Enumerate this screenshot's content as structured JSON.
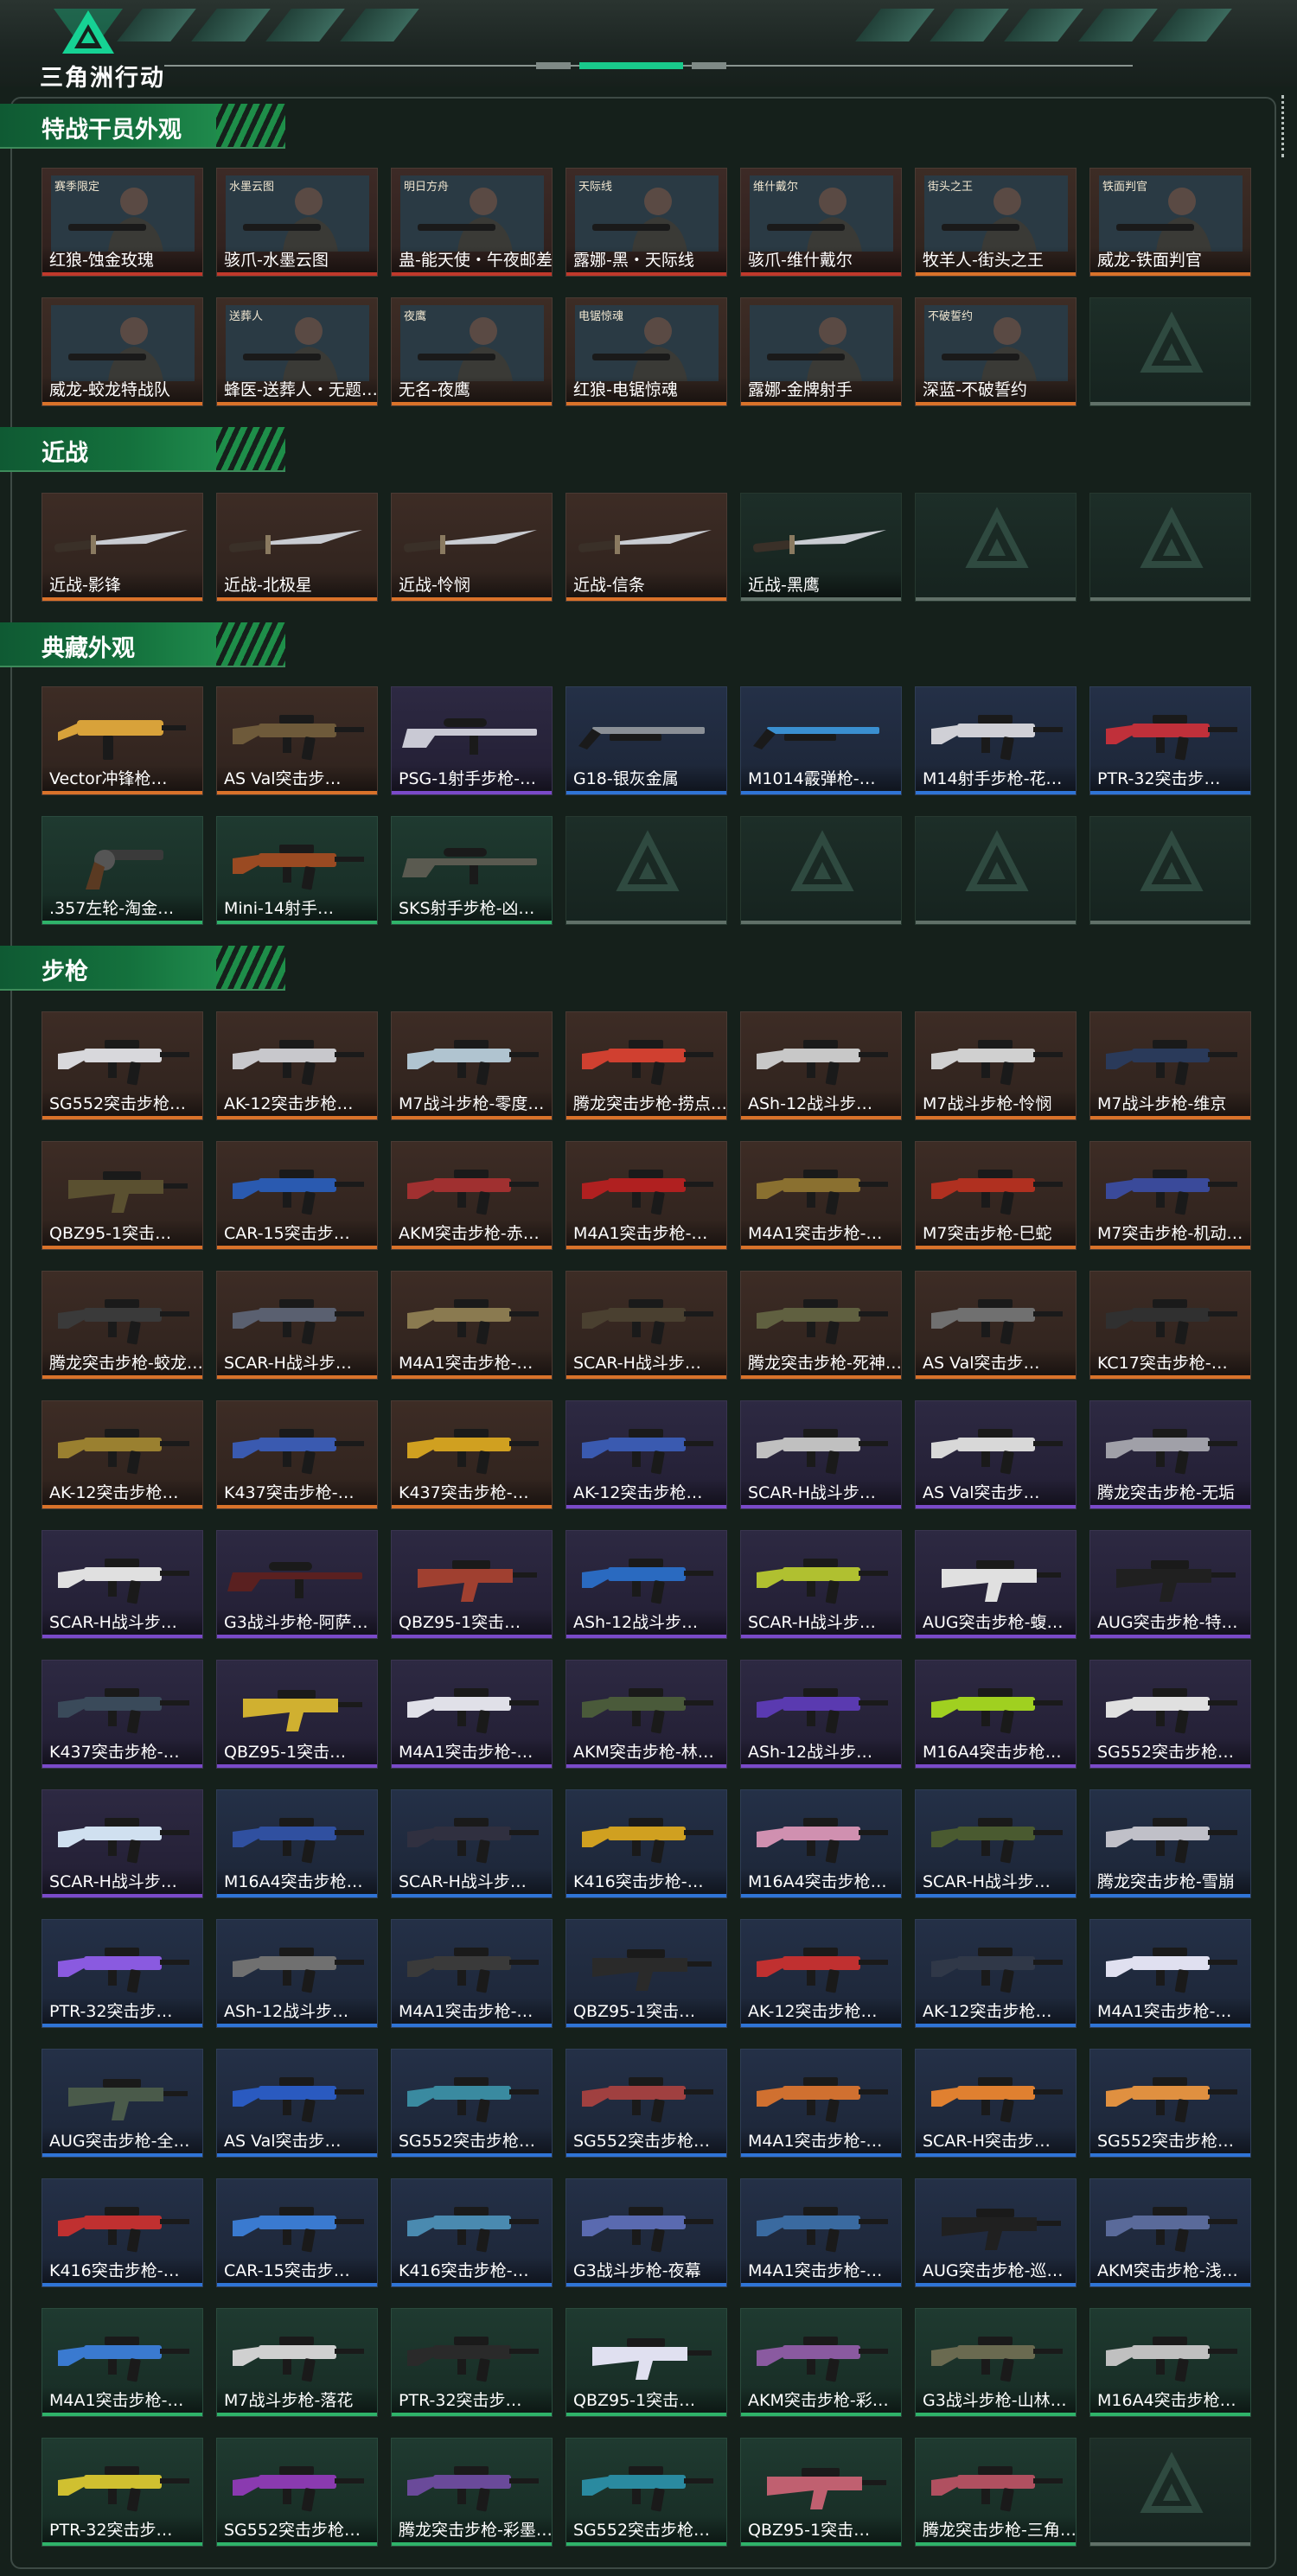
{
  "app": {
    "logo_text": "三角洲行动",
    "logo_icon": "delta-triangle-logo"
  },
  "colors": {
    "section_green": "#14713d",
    "rarity_orange": "#d9722a",
    "rarity_red": "#c0392b",
    "rarity_purple": "#7a4ac9",
    "rarity_blue": "#2f74d6",
    "rarity_green": "#2fb36a"
  },
  "sections": [
    {
      "title": "特战干员外观",
      "kind": "operator",
      "items": [
        {
          "label": "红狼-蚀金玫瑰",
          "rarity": "red",
          "tag": "赛季限定"
        },
        {
          "label": "骇爪-水墨云图",
          "rarity": "red",
          "tag": "水墨云图"
        },
        {
          "label": "蛊-能天使・午夜邮差",
          "rarity": "red",
          "tag": "明日方舟"
        },
        {
          "label": "露娜-黑・天际线",
          "rarity": "red",
          "tag": "天际线"
        },
        {
          "label": "骇爪-维什戴尔",
          "rarity": "red",
          "tag": "维什戴尔"
        },
        {
          "label": "牧羊人-街头之王",
          "rarity": "orange",
          "tag": "街头之王"
        },
        {
          "label": "威龙-铁面判官",
          "rarity": "orange",
          "tag": "铁面判官"
        },
        {
          "label": "威龙-蛟龙特战队",
          "rarity": "orange",
          "tag": ""
        },
        {
          "label": "蜂医-送葬人・无题…",
          "rarity": "orange",
          "tag": "送葬人"
        },
        {
          "label": "无名-夜鹰",
          "rarity": "orange",
          "tag": "夜鹰"
        },
        {
          "label": "红狼-电锯惊魂",
          "rarity": "orange",
          "tag": "电锯惊魂"
        },
        {
          "label": "露娜-金牌射手",
          "rarity": "orange",
          "tag": ""
        },
        {
          "label": "深蓝-不破誓约",
          "rarity": "orange",
          "tag": "不破誓约"
        },
        {
          "label": "",
          "rarity": "empty",
          "tag": ""
        }
      ]
    },
    {
      "title": "近战",
      "kind": "melee",
      "items": [
        {
          "label": "近战-影锋",
          "rarity": "orange"
        },
        {
          "label": "近战-北极星",
          "rarity": "orange"
        },
        {
          "label": "近战-怜悯",
          "rarity": "orange"
        },
        {
          "label": "近战-信条",
          "rarity": "orange"
        },
        {
          "label": "近战-黑鹰",
          "rarity": "empty"
        },
        {
          "label": "",
          "rarity": "empty"
        },
        {
          "label": "",
          "rarity": "empty"
        }
      ]
    },
    {
      "title": "典藏外观",
      "kind": "weapon",
      "items": [
        {
          "label": "Vector冲锋枪…",
          "rarity": "orange",
          "gun": "smg",
          "color": "#d8a23a"
        },
        {
          "label": "AS Val突击步…",
          "rarity": "orange",
          "gun": "rifle",
          "color": "#6e5a3a"
        },
        {
          "label": "PSG-1射手步枪-…",
          "rarity": "purple",
          "gun": "sniper",
          "color": "#c9c9d4"
        },
        {
          "label": "G18-银灰金属",
          "rarity": "blue",
          "gun": "shotgun",
          "color": "#8a8f96"
        },
        {
          "label": "M1014霰弹枪-…",
          "rarity": "blue",
          "gun": "shotgun",
          "color": "#3a8fd0"
        },
        {
          "label": "M14射手步枪-花…",
          "rarity": "blue",
          "gun": "rifle",
          "color": "#d0d0d6"
        },
        {
          "label": "PTR-32突击步…",
          "rarity": "blue",
          "gun": "rifle",
          "color": "#c0303a"
        },
        {
          "label": ".357左轮-淘金…",
          "rarity": "green",
          "gun": "pistol",
          "color": "#3a3a3a"
        },
        {
          "label": "Mini-14射手…",
          "rarity": "green",
          "gun": "rifle",
          "color": "#9a4a22"
        },
        {
          "label": "SKS射手步枪-凶…",
          "rarity": "green",
          "gun": "sniper",
          "color": "#5a5a50"
        },
        {
          "label": "",
          "rarity": "empty"
        },
        {
          "label": "",
          "rarity": "empty"
        },
        {
          "label": "",
          "rarity": "empty"
        },
        {
          "label": "",
          "rarity": "empty"
        }
      ]
    },
    {
      "title": "步枪",
      "kind": "weapon",
      "items": [
        {
          "label": "SG552突击步枪…",
          "rarity": "orange",
          "gun": "rifle",
          "color": "#d8d8dc"
        },
        {
          "label": "AK-12突击步枪…",
          "rarity": "orange",
          "gun": "rifle",
          "color": "#c8c8cc"
        },
        {
          "label": "M7战斗步枪-零度…",
          "rarity": "orange",
          "gun": "rifle",
          "color": "#b0c4d0"
        },
        {
          "label": "腾龙突击步枪-捞点…",
          "rarity": "orange",
          "gun": "rifle",
          "color": "#d04030"
        },
        {
          "label": "ASh-12战斗步…",
          "rarity": "orange",
          "gun": "rifle",
          "color": "#c8c8c8"
        },
        {
          "label": "M7战斗步枪-怜悯",
          "rarity": "orange",
          "gun": "rifle",
          "color": "#d0d0d0"
        },
        {
          "label": "M7战斗步枪-维京",
          "rarity": "orange",
          "gun": "rifle",
          "color": "#2a3a5a"
        },
        {
          "label": "QBZ95-1突击…",
          "rarity": "orange",
          "gun": "bullpup",
          "color": "#5a5030"
        },
        {
          "label": "CAR-15突击步…",
          "rarity": "orange",
          "gun": "rifle",
          "color": "#2a5ab0"
        },
        {
          "label": "AKM突击步枪-赤…",
          "rarity": "orange",
          "gun": "rifle",
          "color": "#a03030"
        },
        {
          "label": "M4A1突击步枪-…",
          "rarity": "orange",
          "gun": "rifle",
          "color": "#b02020"
        },
        {
          "label": "M4A1突击步枪-…",
          "rarity": "orange",
          "gun": "rifle",
          "color": "#8a7030"
        },
        {
          "label": "M7突击步枪-巳蛇",
          "rarity": "orange",
          "gun": "rifle",
          "color": "#b03020"
        },
        {
          "label": "M7突击步枪-机动…",
          "rarity": "orange",
          "gun": "rifle",
          "color": "#3a4a9a"
        },
        {
          "label": "腾龙突击步枪-蛟龙…",
          "rarity": "orange",
          "gun": "rifle",
          "color": "#3a3a3a"
        },
        {
          "label": "SCAR-H战斗步…",
          "rarity": "orange",
          "gun": "rifle",
          "color": "#5a6070"
        },
        {
          "label": "M4A1突击步枪-…",
          "rarity": "orange",
          "gun": "rifle",
          "color": "#8a7a50"
        },
        {
          "label": "SCAR-H战斗步…",
          "rarity": "orange",
          "gun": "rifle",
          "color": "#4a4030"
        },
        {
          "label": "腾龙突击步枪-死神…",
          "rarity": "orange",
          "gun": "rifle",
          "color": "#606040"
        },
        {
          "label": "AS Val突击步…",
          "rarity": "orange",
          "gun": "rifle",
          "color": "#707070"
        },
        {
          "label": "KC17突击步枪-…",
          "rarity": "orange",
          "gun": "rifle",
          "color": "#303030"
        },
        {
          "label": "AK-12突击步枪…",
          "rarity": "orange",
          "gun": "rifle",
          "color": "#9a8030"
        },
        {
          "label": "K437突击步枪-…",
          "rarity": "orange",
          "gun": "rifle",
          "color": "#3a5ab0"
        },
        {
          "label": "K437突击步枪-…",
          "rarity": "orange",
          "gun": "rifle",
          "color": "#d0a020"
        },
        {
          "label": "AK-12突击步枪…",
          "rarity": "purple",
          "gun": "rifle",
          "color": "#3a5ab0"
        },
        {
          "label": "SCAR-H战斗步…",
          "rarity": "purple",
          "gun": "rifle",
          "color": "#c0c0c0"
        },
        {
          "label": "AS Val突击步…",
          "rarity": "purple",
          "gun": "rifle",
          "color": "#d8d8d8"
        },
        {
          "label": "腾龙突击步枪-无垢",
          "rarity": "purple",
          "gun": "rifle",
          "color": "#a0a0a8"
        },
        {
          "label": "SCAR-H战斗步…",
          "rarity": "purple",
          "gun": "rifle",
          "color": "#e0e0e0"
        },
        {
          "label": "G3战斗步枪-阿萨…",
          "rarity": "purple",
          "gun": "sniper",
          "color": "#5a2020"
        },
        {
          "label": "QBZ95-1突击…",
          "rarity": "purple",
          "gun": "bullpup",
          "color": "#a04030"
        },
        {
          "label": "ASh-12战斗步…",
          "rarity": "purple",
          "gun": "rifle",
          "color": "#2a6ac0"
        },
        {
          "label": "SCAR-H战斗步…",
          "rarity": "purple",
          "gun": "rifle",
          "color": "#b0c030"
        },
        {
          "label": "AUG突击步枪-蝮…",
          "rarity": "purple",
          "gun": "bullpup",
          "color": "#e0e0e0"
        },
        {
          "label": "AUG突击步枪-特…",
          "rarity": "purple",
          "gun": "bullpup",
          "color": "#202020"
        },
        {
          "label": "K437突击步枪-…",
          "rarity": "purple",
          "gun": "rifle",
          "color": "#3a4a5a"
        },
        {
          "label": "QBZ95-1突击…",
          "rarity": "purple",
          "gun": "bullpup",
          "color": "#d0b030"
        },
        {
          "label": "M4A1突击步枪-…",
          "rarity": "purple",
          "gun": "rifle",
          "color": "#e0e0e8"
        },
        {
          "label": "AKM突击步枪-林…",
          "rarity": "purple",
          "gun": "rifle",
          "color": "#4a5a3a"
        },
        {
          "label": "ASh-12战斗步…",
          "rarity": "purple",
          "gun": "rifle",
          "color": "#5a3ab0"
        },
        {
          "label": "M16A4突击步枪…",
          "rarity": "purple",
          "gun": "rifle",
          "color": "#a0d020"
        },
        {
          "label": "SG552突击步枪…",
          "rarity": "purple",
          "gun": "rifle",
          "color": "#e0e0e0"
        },
        {
          "label": "SCAR-H战斗步…",
          "rarity": "purple",
          "gun": "rifle",
          "color": "#d0e0f0"
        },
        {
          "label": "M16A4突击步枪…",
          "rarity": "blue",
          "gun": "rifle",
          "color": "#3050a0"
        },
        {
          "label": "SCAR-H战斗步…",
          "rarity": "blue",
          "gun": "rifle",
          "color": "#303040"
        },
        {
          "label": "K416突击步枪-…",
          "rarity": "blue",
          "gun": "rifle",
          "color": "#d0a020"
        },
        {
          "label": "M16A4突击步枪…",
          "rarity": "blue",
          "gun": "rifle",
          "color": "#d090b0"
        },
        {
          "label": "SCAR-H战斗步…",
          "rarity": "blue",
          "gun": "rifle",
          "color": "#4a5a30"
        },
        {
          "label": "腾龙突击步枪-雪崩",
          "rarity": "blue",
          "gun": "rifle",
          "color": "#c0c0c8"
        },
        {
          "label": "PTR-32突击步…",
          "rarity": "blue",
          "gun": "rifle",
          "color": "#8a5ae0"
        },
        {
          "label": "ASh-12战斗步…",
          "rarity": "blue",
          "gun": "rifle",
          "color": "#707070"
        },
        {
          "label": "M4A1突击步枪-…",
          "rarity": "blue",
          "gun": "rifle",
          "color": "#3a3a3a"
        },
        {
          "label": "QBZ95-1突击…",
          "rarity": "blue",
          "gun": "bullpup",
          "color": "#2a2a2a"
        },
        {
          "label": "AK-12突击步枪…",
          "rarity": "blue",
          "gun": "rifle",
          "color": "#c03030"
        },
        {
          "label": "AK-12突击步枪…",
          "rarity": "blue",
          "gun": "rifle",
          "color": "#303848"
        },
        {
          "label": "M4A1突击步枪-…",
          "rarity": "blue",
          "gun": "rifle",
          "color": "#e0e0f0"
        },
        {
          "label": "AUG突击步枪-全…",
          "rarity": "blue",
          "gun": "bullpup",
          "color": "#4a5a4a"
        },
        {
          "label": "AS Val突击步…",
          "rarity": "blue",
          "gun": "rifle",
          "color": "#2a5ac0"
        },
        {
          "label": "SG552突击步枪…",
          "rarity": "blue",
          "gun": "rifle",
          "color": "#3a8aa0"
        },
        {
          "label": "SG552突击步枪…",
          "rarity": "blue",
          "gun": "rifle",
          "color": "#a04040"
        },
        {
          "label": "M4A1突击步枪-…",
          "rarity": "blue",
          "gun": "rifle",
          "color": "#d07030"
        },
        {
          "label": "SCAR-H突击步…",
          "rarity": "blue",
          "gun": "rifle",
          "color": "#e08030"
        },
        {
          "label": "SG552突击步枪…",
          "rarity": "blue",
          "gun": "rifle",
          "color": "#e09040"
        },
        {
          "label": "K416突击步枪-…",
          "rarity": "blue",
          "gun": "rifle",
          "color": "#c03030"
        },
        {
          "label": "CAR-15突击步…",
          "rarity": "blue",
          "gun": "rifle",
          "color": "#3a7ad0"
        },
        {
          "label": "K416突击步枪-…",
          "rarity": "blue",
          "gun": "rifle",
          "color": "#4a8ab0"
        },
        {
          "label": "G3战斗步枪-夜幕",
          "rarity": "blue",
          "gun": "rifle",
          "color": "#5a6ab0"
        },
        {
          "label": "M4A1突击步枪-…",
          "rarity": "blue",
          "gun": "rifle",
          "color": "#3a6aa0"
        },
        {
          "label": "AUG突击步枪-巡…",
          "rarity": "blue",
          "gun": "bullpup",
          "color": "#202020"
        },
        {
          "label": "AKM突击步枪-浅…",
          "rarity": "blue",
          "gun": "rifle",
          "color": "#5a6a9a"
        },
        {
          "label": "M4A1突击步枪-…",
          "rarity": "green",
          "gun": "rifle",
          "color": "#3a7ad0"
        },
        {
          "label": "M7战斗步枪-落花",
          "rarity": "green",
          "gun": "rifle",
          "color": "#d0d0d0"
        },
        {
          "label": "PTR-32突击步…",
          "rarity": "green",
          "gun": "rifle",
          "color": "#2a2a2a"
        },
        {
          "label": "QBZ95-1突击…",
          "rarity": "green",
          "gun": "bullpup",
          "color": "#e0e0f0"
        },
        {
          "label": "AKM突击步枪-彩…",
          "rarity": "green",
          "gun": "rifle",
          "color": "#8a5aa0"
        },
        {
          "label": "G3战斗步枪-山林…",
          "rarity": "green",
          "gun": "rifle",
          "color": "#6a6a50"
        },
        {
          "label": "M16A4突击步枪…",
          "rarity": "green",
          "gun": "rifle",
          "color": "#c0c0c0"
        },
        {
          "label": "PTR-32突击步…",
          "rarity": "green",
          "gun": "rifle",
          "color": "#d0c030"
        },
        {
          "label": "SG552突击步枪…",
          "rarity": "green",
          "gun": "rifle",
          "color": "#8a3ab0"
        },
        {
          "label": "腾龙突击步枪-彩墨…",
          "rarity": "green",
          "gun": "rifle",
          "color": "#6a4a9a"
        },
        {
          "label": "SG552突击步枪…",
          "rarity": "green",
          "gun": "rifle",
          "color": "#2a8aa0"
        },
        {
          "label": "QBZ95-1突击…",
          "rarity": "green",
          "gun": "bullpup",
          "color": "#c06070"
        },
        {
          "label": "腾龙突击步枪-三角…",
          "rarity": "green",
          "gun": "rifle",
          "color": "#b05060"
        },
        {
          "label": "",
          "rarity": "empty"
        }
      ]
    }
  ]
}
